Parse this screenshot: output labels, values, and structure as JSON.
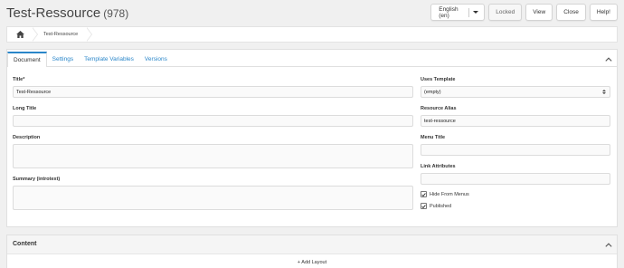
{
  "header": {
    "title": "Test-Ressource",
    "id": "(978)"
  },
  "actions": {
    "language": "English (en)",
    "locked": "Locked",
    "view": "View",
    "close": "Close",
    "help": "Help!"
  },
  "breadcrumb": {
    "home_icon": "home-icon",
    "current": "Test-Ressource"
  },
  "tabs": [
    {
      "label": "Document",
      "active": true
    },
    {
      "label": "Settings",
      "active": false
    },
    {
      "label": "Template Variables",
      "active": false
    },
    {
      "label": "Versions",
      "active": false
    }
  ],
  "form": {
    "title": {
      "label": "Title*",
      "value": "Test-Ressource"
    },
    "long_title": {
      "label": "Long Title",
      "value": ""
    },
    "description": {
      "label": "Description",
      "value": ""
    },
    "summary": {
      "label": "Summary (introtext)",
      "value": ""
    },
    "uses_template": {
      "label": "Uses Template",
      "value": "(empty)"
    },
    "resource_alias": {
      "label": "Resource Alias",
      "value": "test-ressource"
    },
    "menu_title": {
      "label": "Menu Title",
      "value": ""
    },
    "link_attributes": {
      "label": "Link Attributes",
      "value": ""
    },
    "hide_from_menus": {
      "label": "Hide From Menus",
      "checked": true
    },
    "published": {
      "label": "Published",
      "checked": true
    }
  },
  "content": {
    "title": "Content",
    "add_layout": "+ Add Layout"
  },
  "colors": {
    "accent": "#2a86c9",
    "background": "#f0f0f0"
  }
}
